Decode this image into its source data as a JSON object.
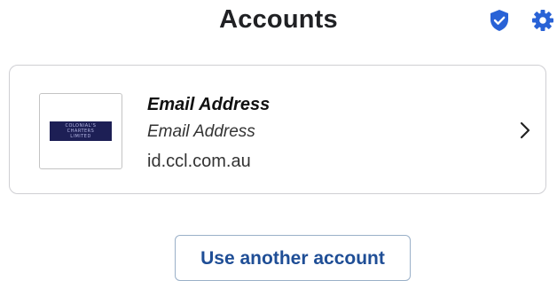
{
  "header": {
    "title": "Accounts",
    "shield_icon": "shield-check-icon",
    "settings_icon": "gear-icon",
    "accent_color": "#2962d6"
  },
  "account": {
    "logo_lines": [
      "COLONIAL'S",
      "CHARTERS",
      "LIMITED"
    ],
    "name": "Email Address",
    "email": "Email Address",
    "domain": "id.ccl.com.au",
    "chevron_icon": "chevron-right-icon"
  },
  "actions": {
    "use_another_label": "Use another account"
  }
}
